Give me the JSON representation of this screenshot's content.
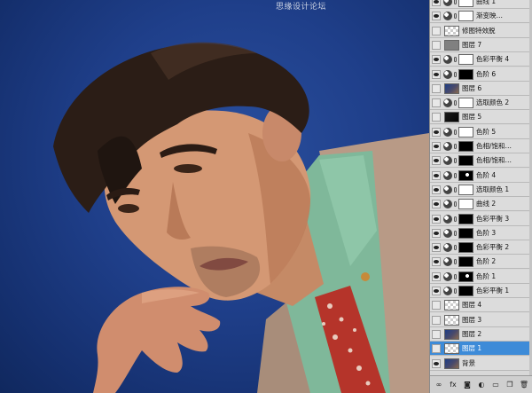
{
  "watermark": "思缘设计论坛",
  "layers": [
    {
      "label": "曲线 1",
      "eye": true,
      "kind": "adjust",
      "thumb": "t-white",
      "selected": false
    },
    {
      "label": "渐变映…",
      "eye": true,
      "kind": "adjust",
      "thumb": "t-white",
      "selected": false
    },
    {
      "label": "修图特效脱",
      "eye": false,
      "kind": "pixel",
      "thumb": "t-checker",
      "selected": false
    },
    {
      "label": "图层 7",
      "eye": false,
      "kind": "pixel",
      "thumb": "t-gray",
      "selected": false
    },
    {
      "label": "色彩平衡 4",
      "eye": true,
      "kind": "adjust",
      "thumb": "t-white",
      "selected": false
    },
    {
      "label": "色阶 6",
      "eye": true,
      "kind": "adjust",
      "thumb": "t-black",
      "selected": false
    },
    {
      "label": "图层 6",
      "eye": false,
      "kind": "pixel",
      "thumb": "t-photo",
      "selected": false
    },
    {
      "label": "选取颜色 2",
      "eye": false,
      "kind": "adjust",
      "thumb": "t-white",
      "selected": false
    },
    {
      "label": "图层 5",
      "eye": false,
      "kind": "pixel",
      "thumb": "t-dark",
      "selected": false
    },
    {
      "label": "色阶 5",
      "eye": true,
      "kind": "adjust",
      "thumb": "t-white",
      "selected": false
    },
    {
      "label": "色相/饱和…",
      "eye": true,
      "kind": "adjust",
      "thumb": "t-black",
      "selected": false
    },
    {
      "label": "色相/饱和…",
      "eye": true,
      "kind": "adjust",
      "thumb": "t-black",
      "selected": false
    },
    {
      "label": "色阶 4",
      "eye": true,
      "kind": "adjust",
      "thumb": "t-blackspot",
      "selected": false
    },
    {
      "label": "选取颜色 1",
      "eye": true,
      "kind": "adjust",
      "thumb": "t-white",
      "selected": false
    },
    {
      "label": "曲线 2",
      "eye": true,
      "kind": "adjust",
      "thumb": "t-white",
      "selected": false
    },
    {
      "label": "色彩平衡 3",
      "eye": true,
      "kind": "adjust",
      "thumb": "t-black",
      "selected": false
    },
    {
      "label": "色阶 3",
      "eye": true,
      "kind": "adjust",
      "thumb": "t-black",
      "selected": false
    },
    {
      "label": "色彩平衡 2",
      "eye": true,
      "kind": "adjust",
      "thumb": "t-black",
      "selected": false
    },
    {
      "label": "色阶 2",
      "eye": true,
      "kind": "adjust",
      "thumb": "t-black",
      "selected": false
    },
    {
      "label": "色阶 1",
      "eye": true,
      "kind": "adjust",
      "thumb": "t-blackspot",
      "selected": false
    },
    {
      "label": "色彩平衡 1",
      "eye": true,
      "kind": "adjust",
      "thumb": "t-black",
      "selected": false
    },
    {
      "label": "图层 4",
      "eye": false,
      "kind": "pixel",
      "thumb": "t-checker",
      "selected": false
    },
    {
      "label": "图层 3",
      "eye": false,
      "kind": "pixel",
      "thumb": "t-checker",
      "selected": false
    },
    {
      "label": "图层 2",
      "eye": false,
      "kind": "pixel",
      "thumb": "t-photo",
      "selected": false
    },
    {
      "label": "图层 1",
      "eye": false,
      "kind": "pixel",
      "thumb": "t-checker",
      "selected": true
    },
    {
      "label": "背景",
      "eye": true,
      "kind": "pixel",
      "thumb": "t-photo",
      "selected": false
    }
  ],
  "toolbar": [
    {
      "name": "link-layers-icon",
      "glyph": "∞"
    },
    {
      "name": "layer-style-icon",
      "glyph": "fx"
    },
    {
      "name": "add-mask-icon",
      "glyph": "◙"
    },
    {
      "name": "new-adjustment-icon",
      "glyph": "◐"
    },
    {
      "name": "new-group-icon",
      "glyph": "▭"
    },
    {
      "name": "new-layer-icon",
      "glyph": "❐"
    },
    {
      "name": "delete-layer-icon",
      "glyph": "🗑"
    }
  ],
  "colors": {
    "selected": "#3d8bd8",
    "backdrop": "#1f3f8a"
  }
}
